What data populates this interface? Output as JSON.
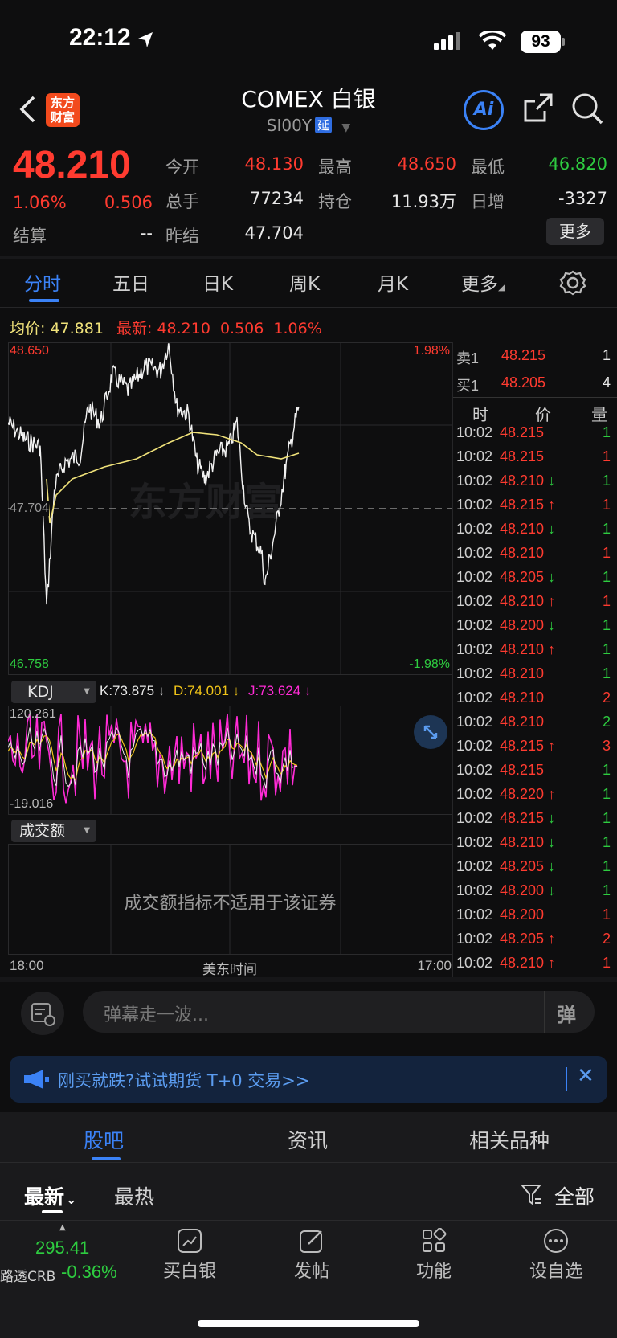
{
  "status_bar": {
    "time": "22:12",
    "battery": "93"
  },
  "header": {
    "title": "COMEX 白银",
    "code": "SI00Y",
    "delay_badge": "延",
    "logo_text": "东方\n财富",
    "ai_label": "Ai"
  },
  "quote": {
    "price": "48.210",
    "change_pct": "1.06%",
    "change": "0.506",
    "settle_label": "结算",
    "settle_value": "--",
    "open_label": "今开",
    "open_value": "48.130",
    "high_label": "最高",
    "high_value": "48.650",
    "low_label": "最低",
    "low_value": "46.820",
    "volume_label": "总手",
    "volume_value": "77234",
    "oi_label": "持仓",
    "oi_value": "11.93万",
    "daily_inc_label": "日增",
    "daily_inc_value": "-3327",
    "prev_settle_label": "昨结",
    "prev_settle_value": "47.704",
    "more_button": "更多"
  },
  "tabs": [
    "分时",
    "五日",
    "日K",
    "周K",
    "月K",
    "更多"
  ],
  "chart": {
    "avg_label": "均价:",
    "avg_value": "47.881",
    "latest_label": "最新:",
    "latest_value": "48.210",
    "latest_change": "0.506",
    "latest_pct": "1.06%",
    "y_high": "48.650",
    "y_low": "46.758",
    "y_ref": "47.704",
    "pct_high": "1.98%",
    "pct_low": "-1.98%",
    "watermark": "东方财富",
    "kdj_button": "KDJ",
    "k_text": "K:73.875 ↓",
    "d_text": "D:74.001 ↓",
    "j_text": "J:73.624 ↓",
    "kdj_high": "120.261",
    "kdj_low": "-19.016",
    "volume_button": "成交额",
    "volume_note": "成交额指标不适用于该证券",
    "x_start": "18:00",
    "x_mid": "美东时间",
    "x_end": "17:00"
  },
  "colors": {
    "up": "#ff3b30",
    "down": "#2ecc40",
    "accent": "#3b82f6",
    "avg_line": "#f0e27a",
    "kdj_j": "#ff2bd6"
  },
  "order_book": {
    "ask_label": "卖1",
    "ask_price": "48.215",
    "ask_qty": "1",
    "bid_label": "买1",
    "bid_price": "48.205",
    "bid_qty": "4"
  },
  "trades_header": {
    "time": "时",
    "price": "价",
    "qty": "量"
  },
  "trades": [
    {
      "time": "10:02",
      "price": "48.215",
      "arrow": "",
      "qty": "1",
      "qty_color": "green"
    },
    {
      "time": "10:02",
      "price": "48.215",
      "arrow": "",
      "qty": "1",
      "qty_color": "red"
    },
    {
      "time": "10:02",
      "price": "48.210",
      "arrow": "↓",
      "qty": "1",
      "qty_color": "green"
    },
    {
      "time": "10:02",
      "price": "48.215",
      "arrow": "↑",
      "qty": "1",
      "qty_color": "red"
    },
    {
      "time": "10:02",
      "price": "48.210",
      "arrow": "↓",
      "qty": "1",
      "qty_color": "green"
    },
    {
      "time": "10:02",
      "price": "48.210",
      "arrow": "",
      "qty": "1",
      "qty_color": "red"
    },
    {
      "time": "10:02",
      "price": "48.205",
      "arrow": "↓",
      "qty": "1",
      "qty_color": "green"
    },
    {
      "time": "10:02",
      "price": "48.210",
      "arrow": "↑",
      "qty": "1",
      "qty_color": "red"
    },
    {
      "time": "10:02",
      "price": "48.200",
      "arrow": "↓",
      "qty": "1",
      "qty_color": "green"
    },
    {
      "time": "10:02",
      "price": "48.210",
      "arrow": "↑",
      "qty": "1",
      "qty_color": "green"
    },
    {
      "time": "10:02",
      "price": "48.210",
      "arrow": "",
      "qty": "1",
      "qty_color": "green"
    },
    {
      "time": "10:02",
      "price": "48.210",
      "arrow": "",
      "qty": "2",
      "qty_color": "red"
    },
    {
      "time": "10:02",
      "price": "48.210",
      "arrow": "",
      "qty": "2",
      "qty_color": "green"
    },
    {
      "time": "10:02",
      "price": "48.215",
      "arrow": "↑",
      "qty": "3",
      "qty_color": "red"
    },
    {
      "time": "10:02",
      "price": "48.215",
      "arrow": "",
      "qty": "1",
      "qty_color": "green"
    },
    {
      "time": "10:02",
      "price": "48.220",
      "arrow": "↑",
      "qty": "1",
      "qty_color": "green"
    },
    {
      "time": "10:02",
      "price": "48.215",
      "arrow": "↓",
      "qty": "1",
      "qty_color": "green"
    },
    {
      "time": "10:02",
      "price": "48.210",
      "arrow": "↓",
      "qty": "1",
      "qty_color": "green"
    },
    {
      "time": "10:02",
      "price": "48.205",
      "arrow": "↓",
      "qty": "1",
      "qty_color": "green"
    },
    {
      "time": "10:02",
      "price": "48.200",
      "arrow": "↓",
      "qty": "1",
      "qty_color": "green"
    },
    {
      "time": "10:02",
      "price": "48.200",
      "arrow": "",
      "qty": "1",
      "qty_color": "red"
    },
    {
      "time": "10:02",
      "price": "48.205",
      "arrow": "↑",
      "qty": "2",
      "qty_color": "red"
    },
    {
      "time": "10:02",
      "price": "48.210",
      "arrow": "↑",
      "qty": "1",
      "qty_color": "red"
    }
  ],
  "danmu": {
    "placeholder": "弹幕走一波...",
    "send_glyph": "弹"
  },
  "ad": {
    "text": "刚买就跌?试试期货 T+0 交易>>"
  },
  "section_tabs": [
    "股吧",
    "资讯",
    "相关品种"
  ],
  "feed_filters": {
    "latest": "最新",
    "hot": "最热",
    "all": "全部"
  },
  "bottom_nav": {
    "ticker_value": "295.41",
    "ticker_name": "路透CRB",
    "ticker_pct": "-0.36%",
    "items": [
      "买白银",
      "发帖",
      "功能",
      "设自选"
    ]
  }
}
